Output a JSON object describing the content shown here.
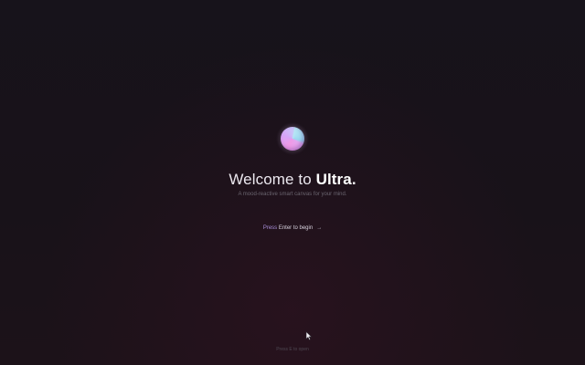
{
  "welcome": {
    "title_prefix": "Welcome to ",
    "title_brand": "Ultra.",
    "subtitle": "A mood-reactive smart canvas for your mind."
  },
  "cta": {
    "press_label": "Press",
    "rest_label": " Enter to begin",
    "arrow": "→"
  },
  "footer": {
    "hint": "Press E to open"
  },
  "icons": {
    "logo": "gradient-orb-icon",
    "cursor": "mouse-pointer-icon"
  },
  "colors": {
    "background": "#17121a",
    "accent": "#a98fd9",
    "title": "#ebe7ee"
  }
}
